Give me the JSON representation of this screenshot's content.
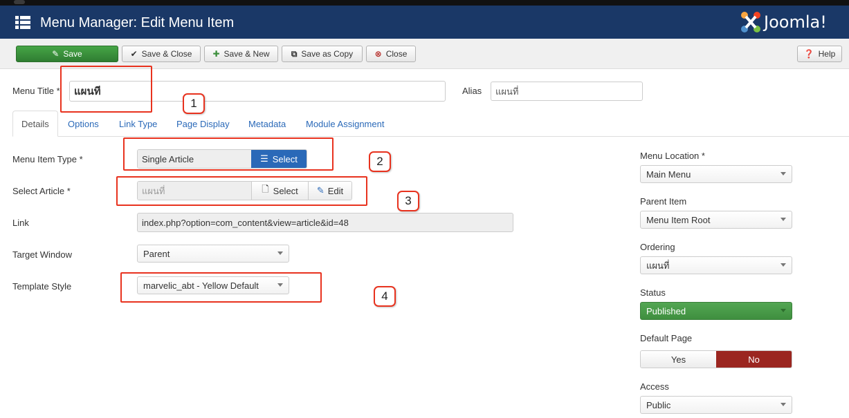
{
  "header": {
    "title": "Menu Manager: Edit Menu Item",
    "logo_text": "Joomla!"
  },
  "toolbar": {
    "save": "Save",
    "save_close": "Save & Close",
    "save_new": "Save & New",
    "save_copy": "Save as Copy",
    "close": "Close",
    "help": "Help"
  },
  "form": {
    "menu_title_label": "Menu Title *",
    "menu_title_value": "แผนที",
    "alias_label": "Alias",
    "alias_value": "แผนที่"
  },
  "tabs": [
    "Details",
    "Options",
    "Link Type",
    "Page Display",
    "Metadata",
    "Module Assignment"
  ],
  "details": {
    "menu_item_type_label": "Menu Item Type *",
    "menu_item_type_value": "Single Article",
    "menu_item_type_select": "Select",
    "select_article_label": "Select Article *",
    "select_article_value": "แผนที่",
    "select_article_select": "Select",
    "select_article_edit": "Edit",
    "link_label": "Link",
    "link_value": "index.php?option=com_content&view=article&id=48",
    "target_window_label": "Target Window",
    "target_window_value": "Parent",
    "template_style_label": "Template Style",
    "template_style_value": "marvelic_abt - Yellow Default"
  },
  "sidebar": {
    "menu_location_label": "Menu Location *",
    "menu_location_value": "Main Menu",
    "parent_item_label": "Parent Item",
    "parent_item_value": "Menu Item Root",
    "ordering_label": "Ordering",
    "ordering_value": "แผนที่",
    "status_label": "Status",
    "status_value": "Published",
    "default_page_label": "Default Page",
    "default_yes": "Yes",
    "default_no": "No",
    "access_label": "Access",
    "access_value": "Public"
  },
  "annotations": [
    "1",
    "2",
    "3",
    "4"
  ],
  "colors": {
    "header_bg": "#1a3867",
    "save_green": "#3c8f3c",
    "annotation_red": "#e8321e",
    "no_active": "#9b2620",
    "link_blue": "#2a69b8"
  }
}
